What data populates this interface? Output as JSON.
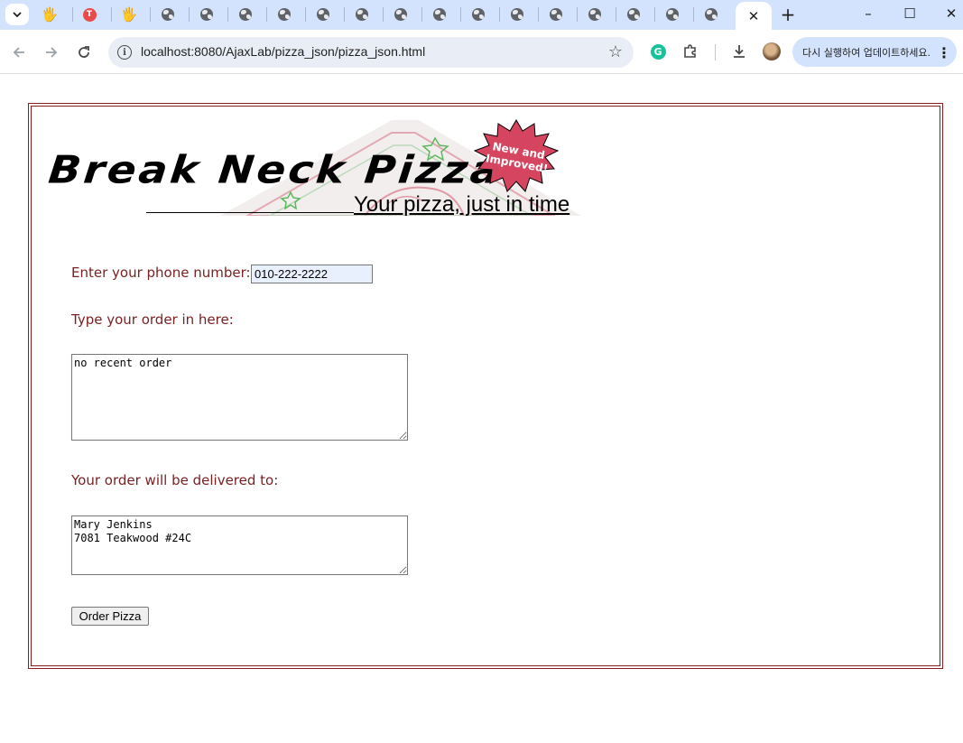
{
  "browser": {
    "active_tab_close": "✕",
    "new_tab": "+",
    "tab_favicons": [
      "hand-icon",
      "red-t-icon",
      "hand-icon",
      "globe-icon",
      "globe-icon",
      "globe-icon",
      "globe-icon",
      "globe-icon",
      "globe-icon",
      "globe-icon",
      "globe-icon",
      "globe-icon",
      "globe-icon",
      "globe-icon",
      "globe-icon",
      "globe-icon",
      "globe-icon"
    ],
    "window_controls": {
      "minimize": "–",
      "maximize": "☐",
      "close": "✕"
    },
    "url": "localhost:8080/AjaxLab/pizza_json/pizza_json.html",
    "update_button": "다시 실행하여 업데이트하세요.",
    "accent_color": "#d3e3fd"
  },
  "page": {
    "logo_text": "Break Neck Pizza",
    "badge_line1": "New and",
    "badge_line2": "Improved!",
    "tagline": "Your pizza, just in time",
    "phone_label": "Enter your phone number:",
    "phone_value": "010-222-2222",
    "order_label": "Type your order in here:",
    "order_value": "no recent order",
    "address_label": "Your order will be delivered to:",
    "address_value": "Mary Jenkins\n7081 Teakwood #24C",
    "submit_label": "Order Pizza",
    "label_color": "#7a1f1f",
    "frame_color": "#8a1c1c",
    "badge_color": "#d64560"
  }
}
